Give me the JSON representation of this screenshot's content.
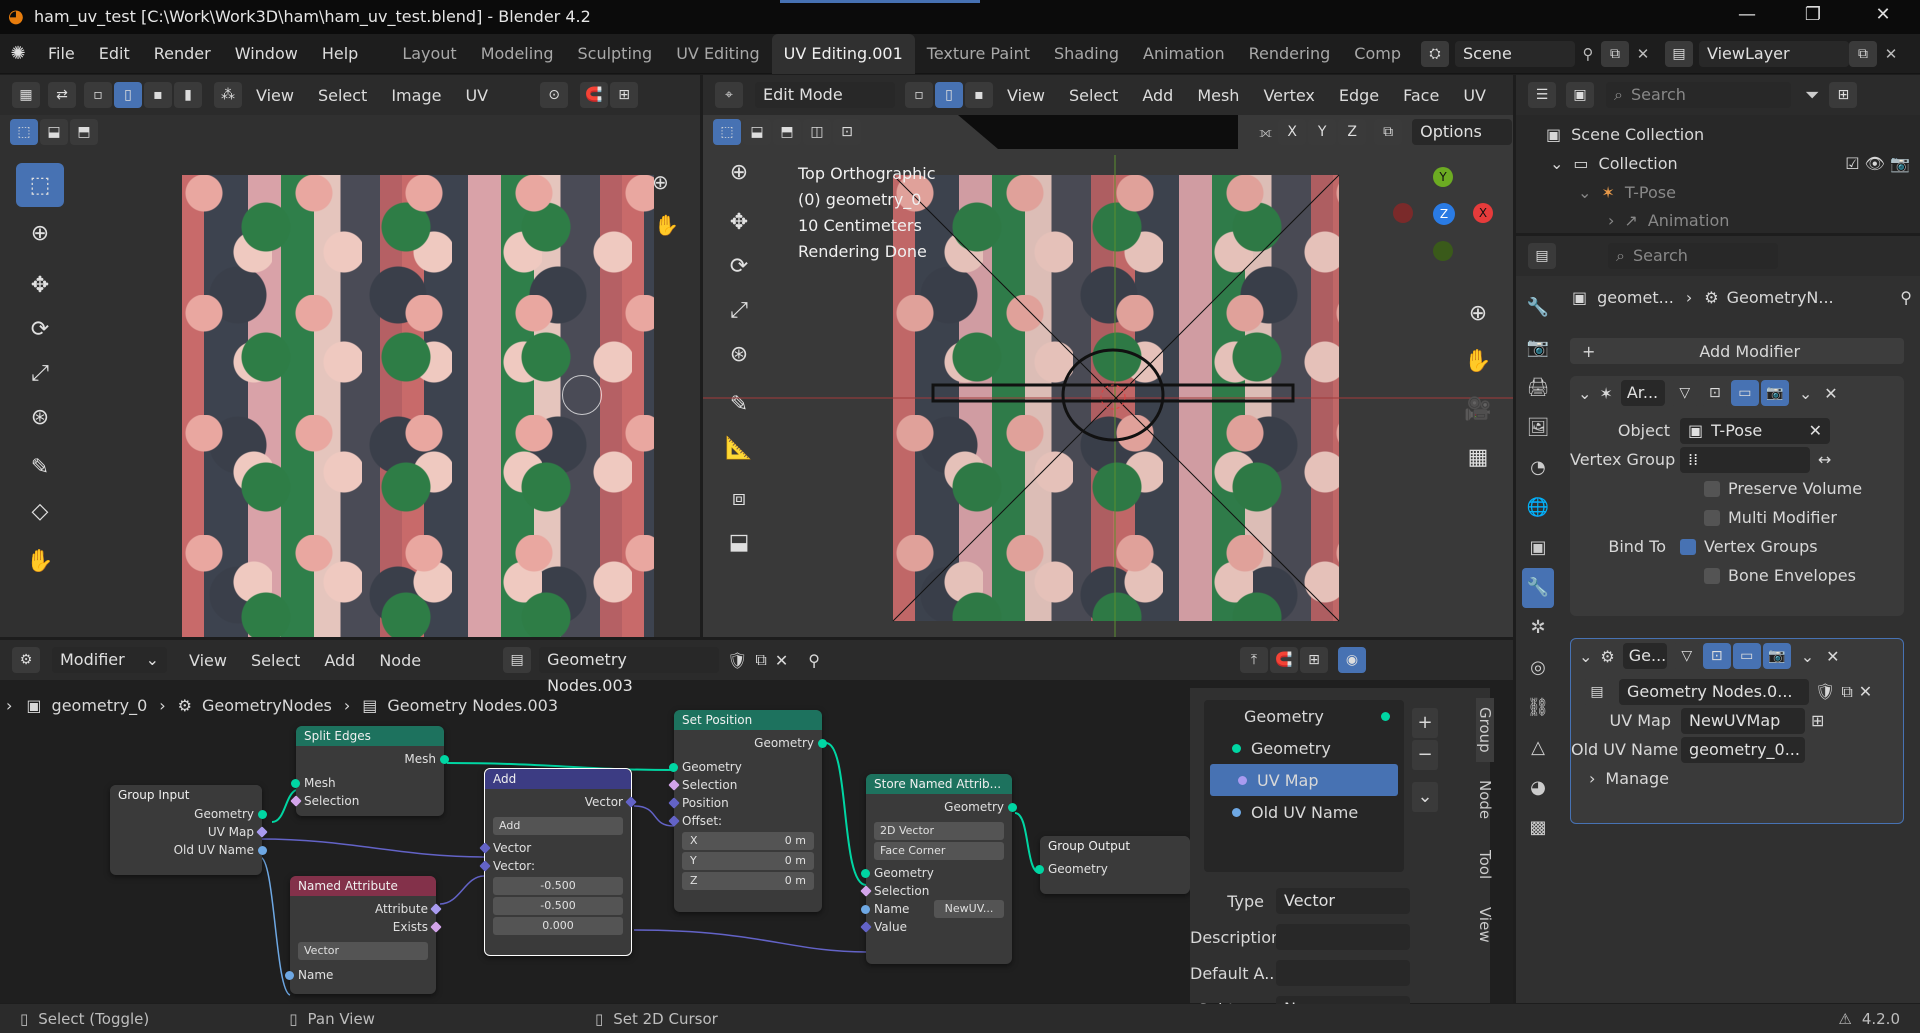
{
  "title_bar": {
    "title": "ham_uv_test [C:\\Work\\Work3D\\ham\\ham_uv_test.blend] - Blender 4.2",
    "minimize": "—",
    "restore": "❐",
    "close": "✕"
  },
  "menu": {
    "items": [
      "File",
      "Edit",
      "Render",
      "Window",
      "Help"
    ]
  },
  "workspaces": [
    "Layout",
    "Modeling",
    "Sculpting",
    "UV Editing",
    "UV Editing.001",
    "Texture Paint",
    "Shading",
    "Animation",
    "Rendering",
    "Comp"
  ],
  "scene": "Scene",
  "view_layer": "ViewLayer",
  "uv_editor": {
    "menus": [
      "View",
      "Select",
      "Image",
      "UV"
    ]
  },
  "viewport": {
    "mode": "Edit Mode",
    "menus": [
      "View",
      "Select",
      "Add",
      "Mesh",
      "Vertex",
      "Edge",
      "Face",
      "UV"
    ],
    "axes": [
      "X",
      "Y",
      "Z"
    ],
    "options": "Options",
    "overlay": [
      "Top Orthographic",
      "(0) geometry_0",
      "10 Centimeters",
      "Rendering Done"
    ],
    "gizmo": {
      "y": "Y",
      "z": "Z",
      "x": "X"
    }
  },
  "outliner": {
    "search": "Search",
    "scene_collection": "Scene Collection",
    "collection": "Collection",
    "tpose": "T-Pose",
    "animation": "Animation"
  },
  "properties": {
    "search": "Search",
    "breadcrumb_obj": "geomet...",
    "breadcrumb_mod": "GeometryN...",
    "add_modifier": "Add Modifier",
    "armature": {
      "name": "Ar...",
      "object_label": "Object",
      "object_value": "T-Pose",
      "vgroup_label": "Vertex Group",
      "preserve_volume": "Preserve Volume",
      "multi_modifier": "Multi Modifier",
      "bind_to": "Bind To",
      "vertex_groups": "Vertex Groups",
      "bone_envelopes": "Bone Envelopes"
    },
    "geonodes": {
      "name": "Ge...",
      "group": "Geometry Nodes.0...",
      "uvmap_label": "UV Map",
      "uvmap_value": "NewUVMap",
      "olduv_label": "Old UV Name",
      "olduv_value": "geometry_0...",
      "manage": "Manage"
    }
  },
  "node_editor": {
    "editor_type": "Modifier",
    "menus": [
      "View",
      "Select",
      "Add",
      "Node"
    ],
    "node_group": "Geometry Nodes.003",
    "breadcrumb": [
      "geometry_0",
      "GeometryNodes",
      "Geometry Nodes.003"
    ],
    "nodes": {
      "group_input": {
        "title": "Group Input",
        "outputs": [
          "Geometry",
          "UV Map",
          "Old UV Name"
        ]
      },
      "split_edges": {
        "title": "Split Edges",
        "output": "Mesh",
        "inputs": [
          "Mesh",
          "Selection"
        ]
      },
      "named_attr": {
        "title": "Named Attribute",
        "outputs": [
          "Attribute",
          "Exists"
        ],
        "type": "Vector",
        "input": "Name"
      },
      "add": {
        "title": "Add",
        "output": "Vector",
        "op": "Add",
        "inputs": [
          "Vector",
          "Vector:"
        ],
        "values": [
          "-0.500",
          "-0.500",
          "0.000"
        ]
      },
      "set_position": {
        "title": "Set Position",
        "output": "Geometry",
        "inputs": [
          "Geometry",
          "Selection",
          "Position",
          "Offset:"
        ],
        "offset": [
          [
            "X",
            "0 m"
          ],
          [
            "Y",
            "0 m"
          ],
          [
            "Z",
            "0 m"
          ]
        ]
      },
      "store_attr": {
        "title": "Store Named Attrib...",
        "output": "Geometry",
        "type": "2D Vector",
        "domain": "Face Corner",
        "inputs": [
          "Geometry",
          "Selection",
          "Name",
          "Value"
        ],
        "name_value": "NewUV..."
      },
      "group_output": {
        "title": "Group Output",
        "input": "Geometry"
      }
    },
    "sidebar": {
      "interface": [
        "Geometry",
        "Geometry",
        "UV Map",
        "Old UV Name"
      ],
      "type_label": "Type",
      "type_value": "Vector",
      "desc_label": "Description",
      "default_label": "Default A...",
      "subtype_label": "Subtype",
      "subtype_value": "None",
      "tabs": [
        "Group",
        "Node",
        "Tool",
        "View"
      ]
    }
  },
  "status": {
    "select": "Select (Toggle)",
    "pan": "Pan View",
    "cursor": "Set 2D Cursor",
    "version": "4.2.0"
  },
  "colors": {
    "accent": "#4772b3",
    "geometry_socket": "#00d6a3",
    "vector_node": "#3c3c83",
    "attribute_node": "#83314a",
    "geometry_node": "#1d725e"
  }
}
